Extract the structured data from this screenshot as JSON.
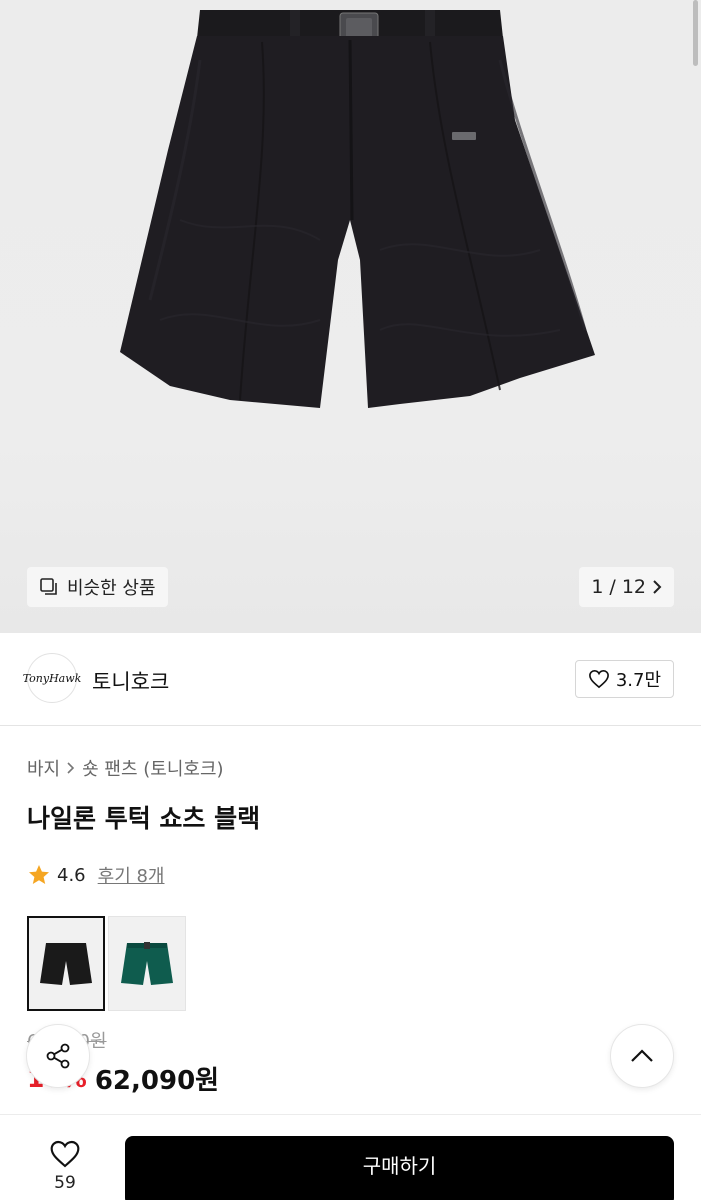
{
  "hero": {
    "similar_label": "비슷한 상품",
    "pager": {
      "current": "1",
      "separator": "/",
      "total": "12"
    }
  },
  "brand": {
    "logo_text": "TonyHawk",
    "name": "토니호크",
    "likes": "3.7만"
  },
  "breadcrumb": {
    "category": "바지",
    "subcategory": "숏 팬츠 (토니호크)"
  },
  "product": {
    "title": "나일론 투턱 쇼츠 블랙",
    "rating": "4.6",
    "reviews": "후기 8개",
    "original_price": "69,000원",
    "discount": "10%",
    "price": "62,090원"
  },
  "swatches": [
    {
      "color_name": "black",
      "color": "#1a1a1a"
    },
    {
      "color_name": "green",
      "color": "#0f5c4e"
    }
  ],
  "bottom_bar": {
    "wish_count": "59",
    "buy_label": "구매하기"
  },
  "colors": {
    "discount": "#e8202a",
    "star": "#f5a623",
    "buy_button": "#000000"
  }
}
